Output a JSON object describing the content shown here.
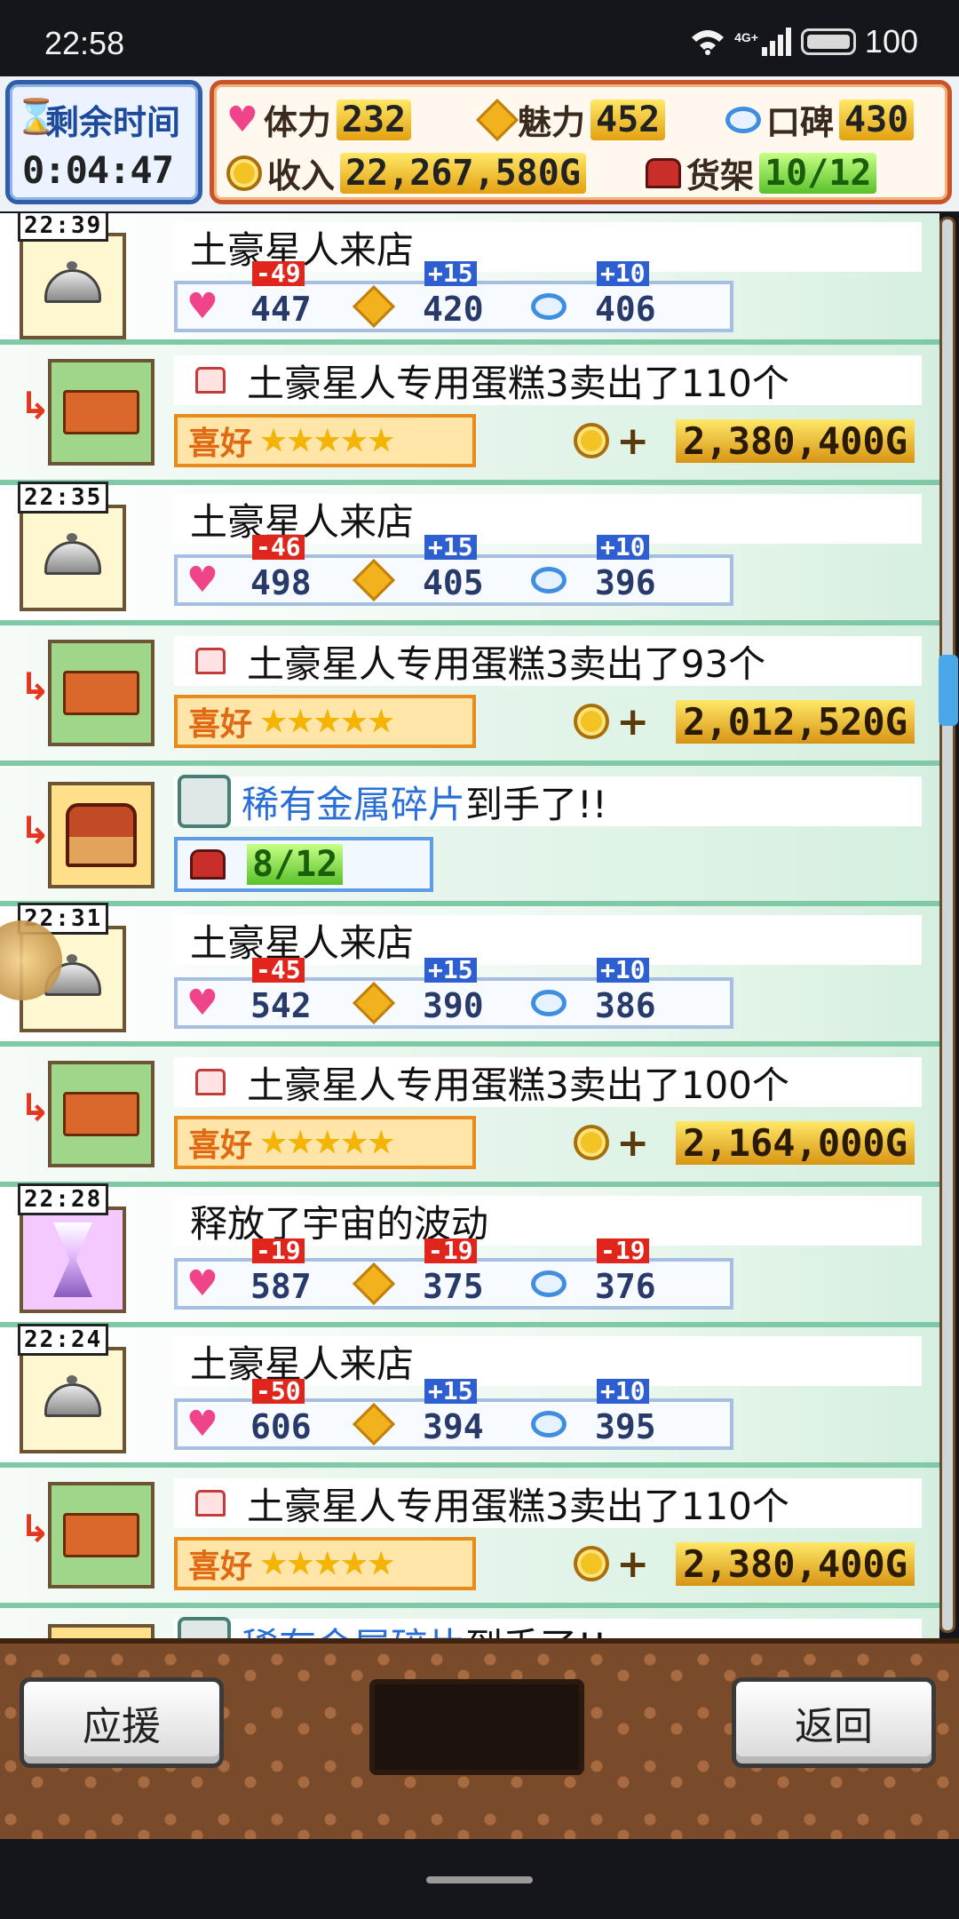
{
  "status_bar": {
    "time": "22:58",
    "network": "4G+",
    "battery": "100"
  },
  "header": {
    "timer_label": "剩余时间",
    "timer_value": "0:04:47",
    "stamina_label": "体力",
    "stamina_value": "232",
    "charm_label": "魅力",
    "charm_value": "452",
    "reputation_label": "口碑",
    "reputation_value": "430",
    "income_label": "收入",
    "income_value": "22,267,580G",
    "shelf_label": "货架",
    "shelf_value": "10/12"
  },
  "log": [
    {
      "type": "visit",
      "time": "22:39",
      "text": "土豪星人来店",
      "stats": [
        "447",
        "420",
        "406"
      ],
      "deltas": [
        "-49",
        "+15",
        "+10"
      ]
    },
    {
      "type": "sale",
      "text": "土豪星人专用蛋糕3卖出了110个",
      "pref": "喜好",
      "stars": "★★★★★",
      "amount": "2,380,400G"
    },
    {
      "type": "visit",
      "time": "22:35",
      "text": "土豪星人来店",
      "stats": [
        "498",
        "405",
        "396"
      ],
      "deltas": [
        "-46",
        "+15",
        "+10"
      ]
    },
    {
      "type": "sale",
      "text": "土豪星人专用蛋糕3卖出了93个",
      "pref": "喜好",
      "stars": "★★★★★",
      "amount": "2,012,520G"
    },
    {
      "type": "item",
      "text_blue": "稀有金属碎片",
      "text_rest": "到手了!!",
      "shelf": "8/12"
    },
    {
      "type": "visit",
      "time": "22:31",
      "text": "土豪星人来店",
      "stats": [
        "542",
        "390",
        "386"
      ],
      "deltas": [
        "-45",
        "+15",
        "+10"
      ]
    },
    {
      "type": "sale",
      "text": "土豪星人专用蛋糕3卖出了100个",
      "pref": "喜好",
      "stars": "★★★★★",
      "amount": "2,164,000G"
    },
    {
      "type": "event",
      "time": "22:28",
      "text": "释放了宇宙的波动",
      "stats": [
        "587",
        "375",
        "376"
      ],
      "deltas": [
        "-19",
        "-19",
        "-19"
      ]
    },
    {
      "type": "visit",
      "time": "22:24",
      "text": "土豪星人来店",
      "stats": [
        "606",
        "394",
        "395"
      ],
      "deltas": [
        "-50",
        "+15",
        "+10"
      ]
    },
    {
      "type": "sale",
      "text": "土豪星人专用蛋糕3卖出了110个",
      "pref": "喜好",
      "stars": "★★★★★",
      "amount": "2,380,400G"
    },
    {
      "type": "item",
      "text_blue": "稀有金属碎片",
      "text_rest": "到手了!!"
    }
  ],
  "buttons": {
    "support": "应援",
    "back": "返回"
  },
  "colors": {
    "accent_blue": "#2a6fd8",
    "negative": "#e0261c",
    "positive": "#2e5fd0",
    "gold": "#f3c324"
  }
}
